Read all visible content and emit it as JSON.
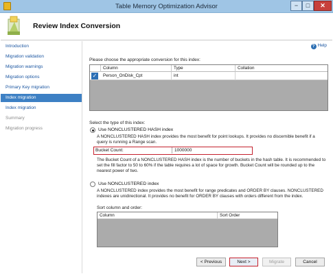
{
  "window": {
    "title": "Table Memory Optimization Advisor",
    "controls": {
      "minimize": "−",
      "maximize": "□",
      "close": "✕"
    }
  },
  "header": {
    "title": "Review Index Conversion"
  },
  "sidebar": {
    "items": [
      {
        "label": "Introduction",
        "state": "link"
      },
      {
        "label": "Migration validation",
        "state": "link"
      },
      {
        "label": "Migration warnings",
        "state": "link"
      },
      {
        "label": "Migration options",
        "state": "link"
      },
      {
        "label": "Primary Key migration",
        "state": "link"
      },
      {
        "label": "Index migration",
        "state": "active"
      },
      {
        "label": "Index migration",
        "state": "link"
      },
      {
        "label": "Summary",
        "state": "disabled"
      },
      {
        "label": "Migration progress",
        "state": "disabled"
      }
    ]
  },
  "main": {
    "help_label": "Help",
    "choose_prompt": "Please choose the appropriate conversion for this index:",
    "index_grid": {
      "headers": [
        "Column",
        "Type",
        "Collation"
      ],
      "rows": [
        {
          "checked": true,
          "column": "Person_OnDisk_Cpt",
          "type": "int",
          "collation": ""
        }
      ]
    },
    "select_type_prompt": "Select the type of this index:",
    "hash_option": {
      "label": "Use NONCLUSTERED HASH index",
      "selected": true,
      "description": "A NONCLUSTERED HASH index provides the most benefit for point lookups. It provides no discernible benefit if a query is running a Range scan.",
      "bucket_label": "Bucket Count:",
      "bucket_value": "1000000",
      "bucket_description": "The Bucket Count of a NONCLUSTERED HASH index is the number of buckets in the hash table. It is recommended to set the fill factor to 50 to 60% if the table requires a lot of space for growth. Bucket Count will be rounded up to the nearest power of two."
    },
    "nonclustered_option": {
      "label": "Use NONCLUSTERED index",
      "selected": false,
      "description": "A NONCLUSTERED index provides the most benefit for range predicates and ORDER BY clauses. NONCLUSTERED indexes are unidirectional. It provides no benefit for ORDER BY clauses with orders different from the index.",
      "sort_prompt": "Sort column and order:",
      "sort_headers": [
        "Column",
        "Sort Order"
      ]
    }
  },
  "footer": {
    "previous": "< Previous",
    "next": "Next >",
    "migrate": "Migrate",
    "cancel": "Cancel"
  },
  "colors": {
    "titlebar": "#9fc5e5",
    "active_nav": "#3d80c4",
    "link": "#1a55a0",
    "highlight": "#c41e2a",
    "grid_empty": "#ababab"
  }
}
